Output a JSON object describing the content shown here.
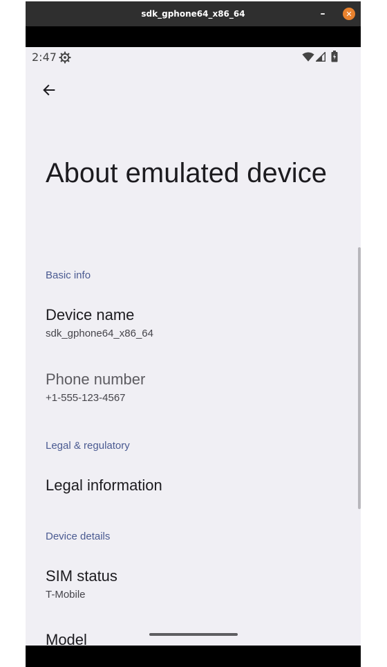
{
  "window": {
    "title": "sdk_gphone64_x86_64",
    "minimize_label": "–",
    "close_label": "✕"
  },
  "status_bar": {
    "time": "2:47",
    "icons": [
      "gear-icon",
      "wifi-icon",
      "cell-signal-icon",
      "battery-icon"
    ]
  },
  "toolbar": {
    "back_icon": "arrow-back-icon"
  },
  "page": {
    "title": "About emulated device"
  },
  "sections": [
    {
      "header": "Basic info",
      "items": [
        {
          "title": "Device name",
          "summary": "sdk_gphone64_x86_64"
        },
        {
          "title": "Phone number",
          "summary": "+1-555-123-4567"
        }
      ]
    },
    {
      "header": "Legal & regulatory",
      "items": [
        {
          "title": "Legal information"
        }
      ]
    },
    {
      "header": "Device details",
      "items": [
        {
          "title": "SIM status",
          "summary": "T-Mobile"
        },
        {
          "title": "Model"
        }
      ]
    }
  ],
  "colors": {
    "screen_bg": "#f0eff4",
    "section_header": "#4a5a91",
    "title_text": "#1c1b1f",
    "titlebar_bg": "#2f2f2f",
    "close_button": "#e9822e"
  }
}
